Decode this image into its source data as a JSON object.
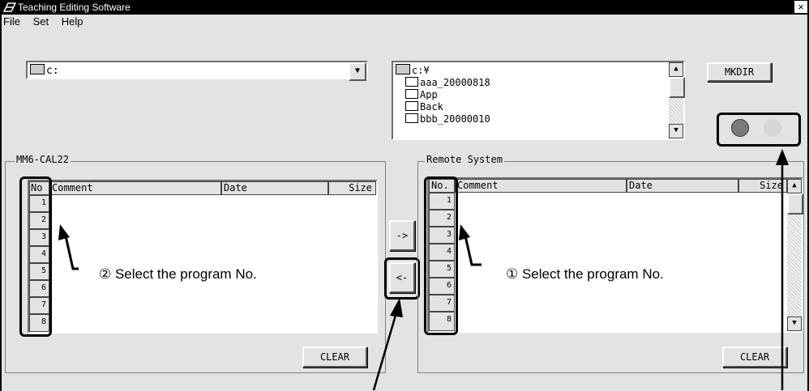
{
  "window": {
    "title": "Teaching Editing Software",
    "close": "×"
  },
  "menu": [
    "File",
    "Set",
    "Help"
  ],
  "drive_select": {
    "value": "c:"
  },
  "dir_tree": {
    "items": [
      "c:¥",
      "aaa_20000818",
      "App",
      "Back",
      "bbb_20000010"
    ]
  },
  "mkdir_label": "MKDIR",
  "left_panel": {
    "title": "MM6-CAL22",
    "columns": [
      "No",
      "Comment",
      "Date",
      "Size"
    ],
    "rows": [
      "1",
      "2",
      "3",
      "4",
      "5",
      "6",
      "7",
      "8"
    ],
    "clear_label": "CLEAR",
    "note": "② Select the program No."
  },
  "right_panel": {
    "title": "Remote System",
    "columns": [
      "No.",
      "Comment",
      "Date",
      "Size"
    ],
    "rows": [
      "1",
      "2",
      "3",
      "4",
      "5",
      "6",
      "7",
      "8"
    ],
    "clear_label": "CLEAR",
    "note": "① Select the program No."
  },
  "transfer": {
    "to_remote": "->",
    "to_local": "<-"
  },
  "indicator": {
    "led1_color": "#7a7a7a",
    "led2_color": "#d6d6d6"
  }
}
